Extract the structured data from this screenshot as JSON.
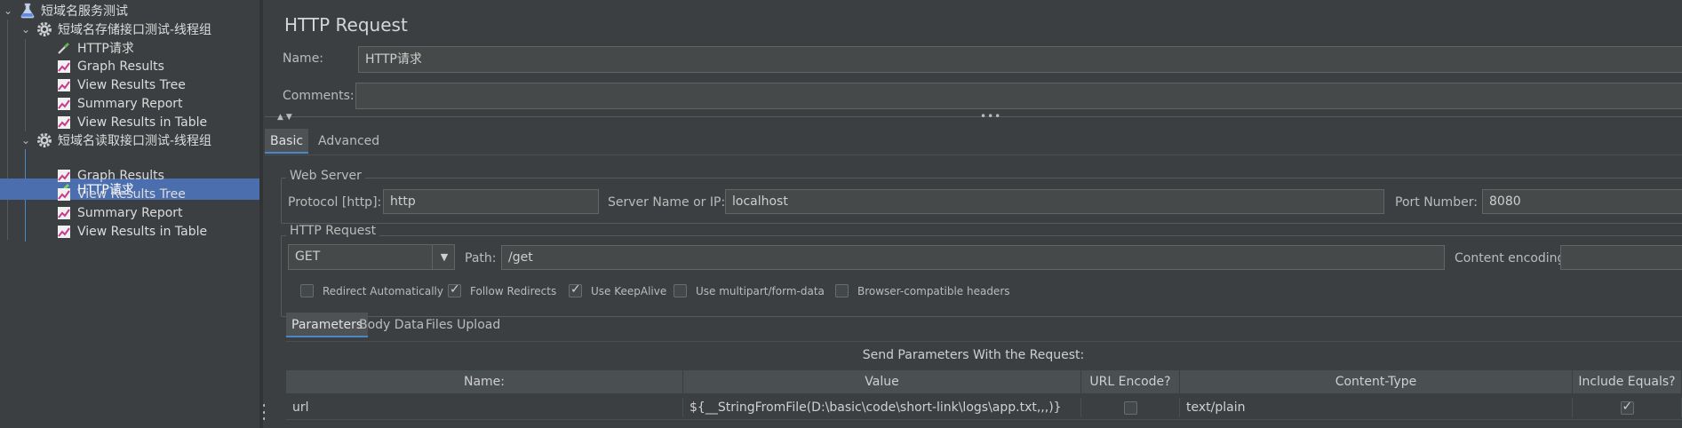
{
  "tree": {
    "root": {
      "label": "短域名服务测试",
      "icon": "flask-icon"
    },
    "groups": [
      {
        "label": "短域名存储接口测试-线程组",
        "icon": "gear-icon",
        "children": [
          {
            "label": "HTTP请求",
            "icon": "pipette-icon"
          },
          {
            "label": "Graph Results",
            "icon": "chart-icon"
          },
          {
            "label": "View Results Tree",
            "icon": "chart-icon"
          },
          {
            "label": "Summary Report",
            "icon": "chart-icon"
          },
          {
            "label": "View Results in Table",
            "icon": "chart-icon"
          }
        ]
      },
      {
        "label": "短域名读取接口测试-线程组",
        "icon": "gear-icon",
        "children": [
          {
            "label": "HTTP请求",
            "icon": "pipette-icon",
            "selected": true
          },
          {
            "label": "Graph Results",
            "icon": "chart-icon"
          },
          {
            "label": "View Results Tree",
            "icon": "chart-icon"
          },
          {
            "label": "Summary Report",
            "icon": "chart-icon"
          },
          {
            "label": "View Results in Table",
            "icon": "chart-icon"
          }
        ]
      }
    ]
  },
  "panel": {
    "title": "HTTP Request",
    "name_label": "Name:",
    "name_value": "HTTP请求",
    "comments_label": "Comments:",
    "comments_value": ""
  },
  "tabs": {
    "basic": "Basic",
    "advanced": "Advanced"
  },
  "web_server": {
    "section": "Web Server",
    "protocol_label": "Protocol [http]:",
    "protocol_value": "http",
    "server_label": "Server Name or IP:",
    "server_value": "localhost",
    "port_label": "Port Number:",
    "port_value": "8080"
  },
  "http_request": {
    "section": "HTTP Request",
    "method": "GET",
    "path_label": "Path:",
    "path_value": "/get",
    "encoding_label": "Content encoding:",
    "encoding_value": ""
  },
  "options": {
    "redirect_auto": "Redirect Automatically",
    "follow_redirects": "Follow Redirects",
    "keepalive": "Use KeepAlive",
    "multipart": "Use multipart/form-data",
    "browser_headers": "Browser-compatible headers"
  },
  "subtabs": {
    "parameters": "Parameters",
    "body": "Body Data",
    "files": "Files Upload"
  },
  "params": {
    "caption": "Send Parameters With the Request:",
    "headers": [
      "Name:",
      "Value",
      "URL Encode?",
      "Content-Type",
      "Include Equals?"
    ],
    "rows": [
      {
        "name": "url",
        "value": "${__StringFromFile(D:\\basic\\code\\short-link\\logs\\app.txt,,,)}",
        "url_encode": false,
        "content_type": "text/plain",
        "include_equals": true
      }
    ]
  },
  "colors": {
    "selection": "#4b6eaf",
    "background": "#3c3f41",
    "field": "#45494a"
  }
}
